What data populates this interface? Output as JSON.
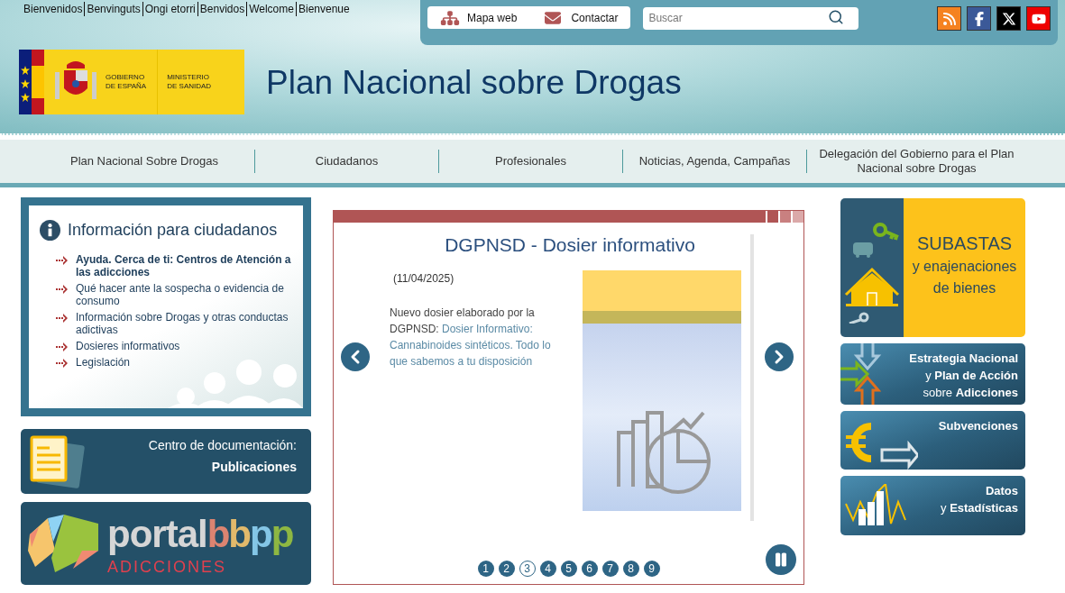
{
  "language_links": [
    "Bienvenidos",
    "Benvinguts",
    "Ongi etorri",
    "Benvidos",
    "Welcome",
    "Bienvenue"
  ],
  "top_links": [
    {
      "kind": "sitemap",
      "label": "Mapa web"
    },
    {
      "kind": "mail",
      "label": "Contactar"
    }
  ],
  "search": {
    "placeholder": "Buscar"
  },
  "social": [
    {
      "kind": "rss"
    },
    {
      "kind": "facebook"
    },
    {
      "kind": "x"
    },
    {
      "kind": "youtube"
    }
  ],
  "logo": {
    "government": [
      "GOBIERNO",
      "DE ESPAÑA"
    ],
    "ministry": [
      "MINISTERIO",
      "DE SANIDAD"
    ]
  },
  "site_title": "Plan Nacional sobre Drogas",
  "nav": [
    "Plan Nacional Sobre Drogas",
    "Ciudadanos",
    "Profesionales",
    "Noticias, Agenda, Campañas",
    "Delegación del Gobierno para el Plan Nacional sobre Drogas"
  ],
  "info_box": {
    "title": "Información para ciudadanos",
    "items": [
      {
        "label": "Ayuda. Cerca de ti: Centros de Atención a las adicciones",
        "bold": true
      },
      {
        "label": "Qué hacer ante la sospecha o evidencia de consumo",
        "bold": false
      },
      {
        "label": "Información sobre Drogas y otras conductas adictivas",
        "bold": false
      },
      {
        "label": "Dosieres informativos",
        "bold": false
      },
      {
        "label": "Legislación",
        "bold": false
      }
    ]
  },
  "documentation": {
    "label": "Centro de documentación:",
    "title": "Publicaciones"
  },
  "portal": {
    "name": "portal",
    "accent": "bbpp",
    "subtitle": "ADICCIONES"
  },
  "carousel": {
    "slides": [
      {
        "title": "DGPNSD - Dosier informativo",
        "date": "(11/04/2025)",
        "text": "Nuevo dosier elaborado por la DGPNSD: ",
        "link": "Dosier Informativo: Cannabinoides sintéticos. Todo lo que sabemos a tu disposición"
      }
    ],
    "pages": [
      {
        "label": "1",
        "selected": false
      },
      {
        "label": "2",
        "selected": false
      },
      {
        "label": "3",
        "selected": true
      },
      {
        "label": "4",
        "selected": false
      },
      {
        "label": "5",
        "selected": false
      },
      {
        "label": "6",
        "selected": false
      },
      {
        "label": "7",
        "selected": false
      },
      {
        "label": "8",
        "selected": false
      },
      {
        "label": "9",
        "selected": false
      }
    ]
  },
  "tiles": [
    {
      "kind": "auction",
      "lines": [
        "SUBASTAS",
        "y enajenaciones",
        "de bienes"
      ]
    },
    {
      "kind": "strategy",
      "lines": [
        "**Estrategia Nacional**",
        "y **Plan de Acción**",
        "sobre **Adicciones**"
      ]
    },
    {
      "kind": "grants",
      "lines": [
        "**Subvenciones**"
      ]
    },
    {
      "kind": "stats",
      "lines": [
        "**Datos**",
        "y **Estadísticas**"
      ]
    }
  ]
}
